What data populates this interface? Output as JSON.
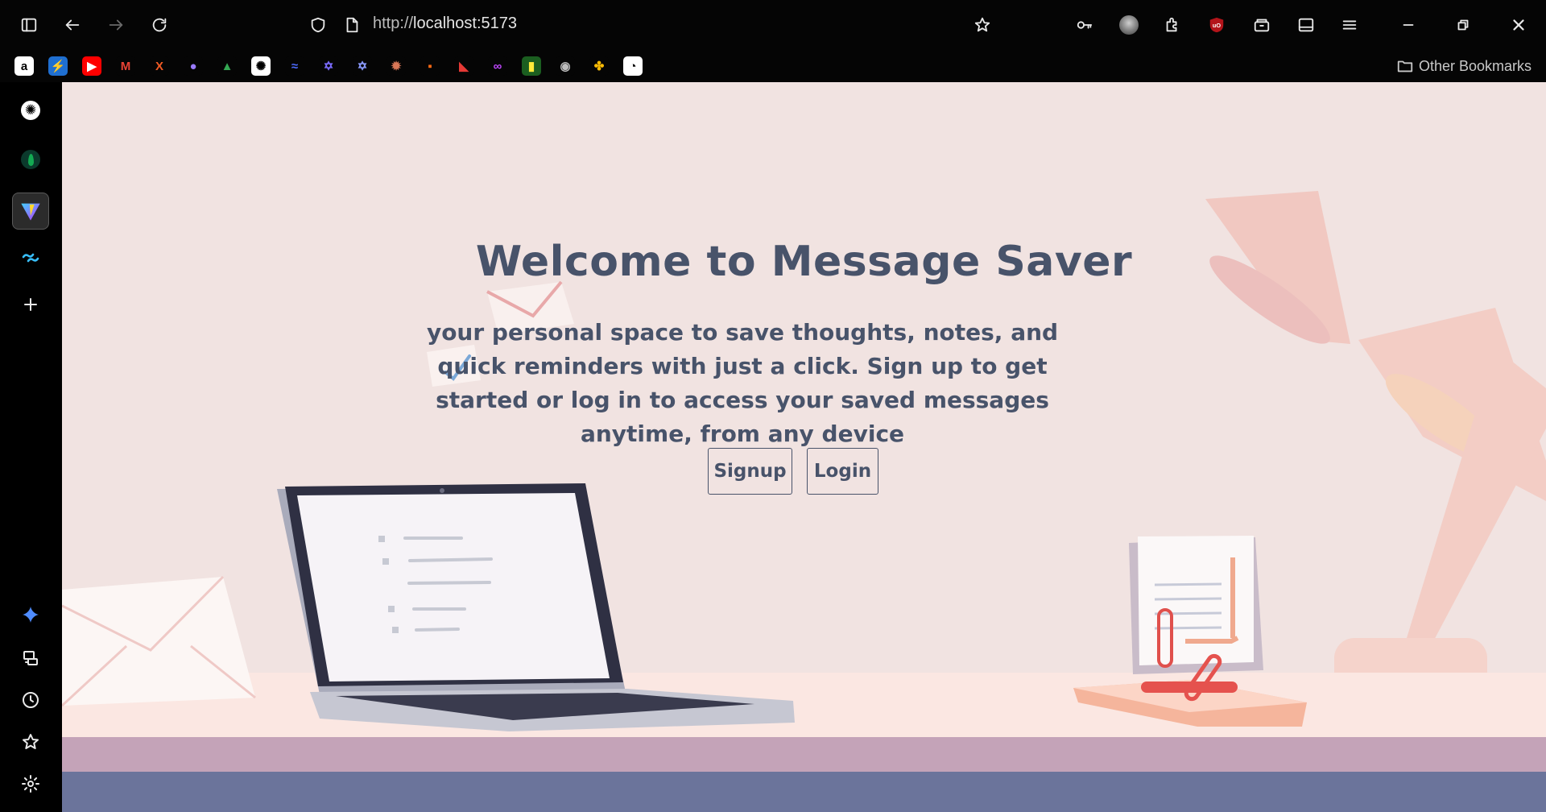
{
  "browser": {
    "url": "http://localhost:5173",
    "url_prefix": "http://",
    "url_host": "localhost:5173",
    "other_bookmarks_label": "Other Bookmarks"
  },
  "bookmarks": [
    {
      "name": "amazon",
      "glyph": "a",
      "bg": "#ffffff",
      "fg": "#000000"
    },
    {
      "name": "firefox-relay",
      "glyph": "⚡",
      "bg": "#1f6fd1",
      "fg": "#ffd64a"
    },
    {
      "name": "youtube",
      "glyph": "▶",
      "bg": "#ff0000",
      "fg": "#ffffff"
    },
    {
      "name": "gmail",
      "glyph": "M",
      "bg": "#050505",
      "fg": "#ea4335"
    },
    {
      "name": "x-tool",
      "glyph": "X",
      "bg": "#050505",
      "fg": "#f15a24"
    },
    {
      "name": "orb-app",
      "glyph": "●",
      "bg": "#050505",
      "fg": "#9a7bff"
    },
    {
      "name": "google-drive",
      "glyph": "▲",
      "bg": "#050505",
      "fg": "#34a853"
    },
    {
      "name": "chatgpt",
      "glyph": "✺",
      "bg": "#ffffff",
      "fg": "#000000"
    },
    {
      "name": "deepseek",
      "glyph": "≈",
      "bg": "#050505",
      "fg": "#4d6bfe"
    },
    {
      "name": "star-app-1",
      "glyph": "✡",
      "bg": "#050505",
      "fg": "#7c6cff"
    },
    {
      "name": "star-app-2",
      "glyph": "✡",
      "bg": "#050505",
      "fg": "#8b9bff"
    },
    {
      "name": "claude",
      "glyph": "✹",
      "bg": "#050505",
      "fg": "#d97757"
    },
    {
      "name": "orange-app",
      "glyph": "▪",
      "bg": "#050505",
      "fg": "#ff6a13"
    },
    {
      "name": "flag-app",
      "glyph": "◣",
      "bg": "#050505",
      "fg": "#e53935"
    },
    {
      "name": "infinity-app",
      "glyph": "∞",
      "bg": "#050505",
      "fg": "#c147ff"
    },
    {
      "name": "bars-app",
      "glyph": "▮",
      "bg": "#1b5e20",
      "fg": "#ffeb3b"
    },
    {
      "name": "github",
      "glyph": "◉",
      "bg": "#050505",
      "fg": "#bdbdbd"
    },
    {
      "name": "photos",
      "glyph": "✤",
      "bg": "#050505",
      "fg": "#fbbc05"
    },
    {
      "name": "ghost-app",
      "glyph": "◔",
      "bg": "#ffffff",
      "fg": "#000000"
    }
  ],
  "sidebar": {
    "items": [
      {
        "name": "chatgpt-panel"
      },
      {
        "name": "mongodb-panel"
      },
      {
        "name": "vite-panel"
      },
      {
        "name": "tailwind-panel"
      },
      {
        "name": "add-panel"
      }
    ],
    "bottom": [
      {
        "name": "sparkle"
      },
      {
        "name": "sync"
      },
      {
        "name": "history"
      },
      {
        "name": "bookmarks"
      },
      {
        "name": "settings"
      }
    ]
  },
  "hero": {
    "title": "Welcome to Message Saver",
    "subtitle": "your personal space to save thoughts, notes, and quick reminders with just a click. Sign up to get started or log in to access your saved messages anytime, from any device",
    "signup_label": "Signup",
    "login_label": "Login"
  },
  "colors": {
    "page_bg": "#f1e3e1",
    "text": "#48536a",
    "desk": "#fbe7e2",
    "band_mauve": "#c4a3b8",
    "band_slate": "#6b749b",
    "lamp": "#f4b9ad"
  }
}
